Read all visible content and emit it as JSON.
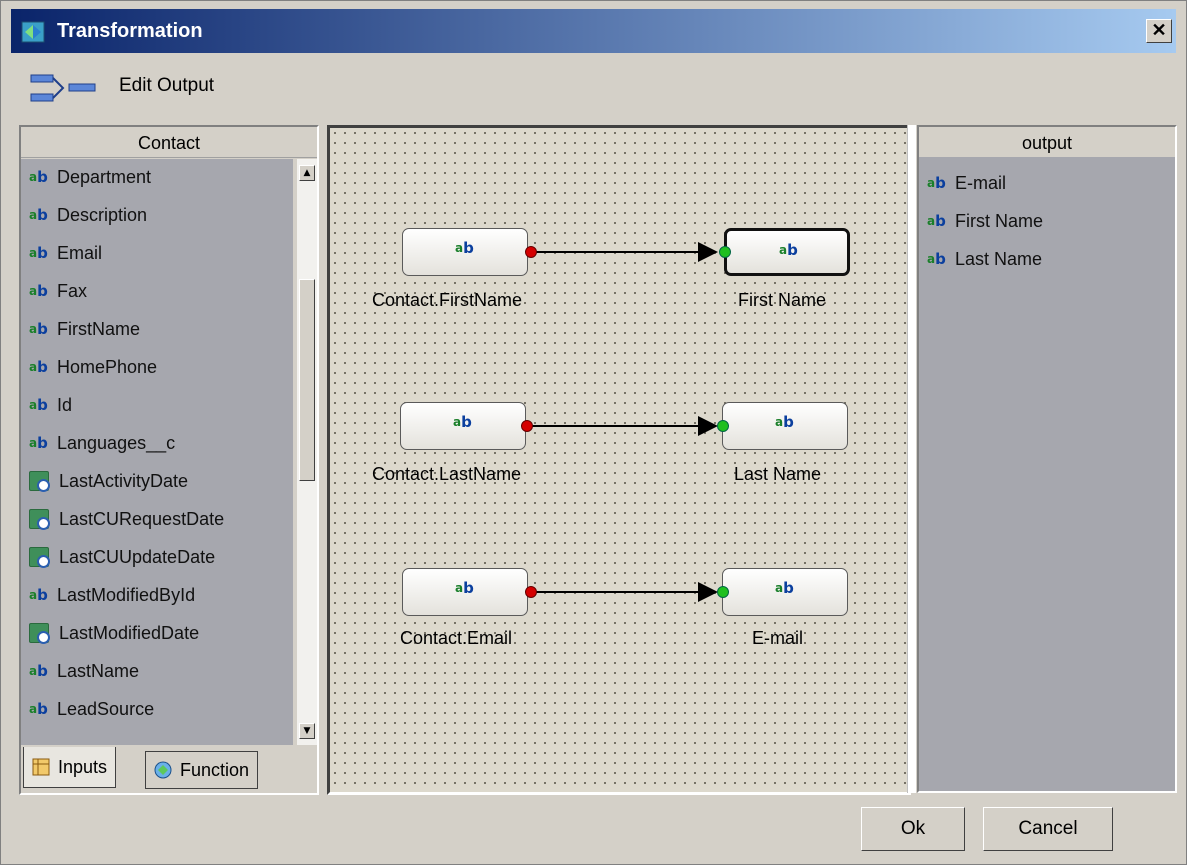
{
  "window": {
    "title": "Transformation",
    "close_label": "✕"
  },
  "toolbar": {
    "label": "Edit Output"
  },
  "left_panel": {
    "header": "Contact",
    "items": [
      {
        "label": "Department",
        "icon": "text-field-icon"
      },
      {
        "label": "Description",
        "icon": "text-field-icon"
      },
      {
        "label": "Email",
        "icon": "text-field-icon"
      },
      {
        "label": "Fax",
        "icon": "text-field-icon"
      },
      {
        "label": "FirstName",
        "icon": "text-field-icon"
      },
      {
        "label": "HomePhone",
        "icon": "text-field-icon"
      },
      {
        "label": "Id",
        "icon": "text-field-icon"
      },
      {
        "label": "Languages__c",
        "icon": "text-field-icon"
      },
      {
        "label": "LastActivityDate",
        "icon": "date-field-icon"
      },
      {
        "label": "LastCURequestDate",
        "icon": "date-field-icon"
      },
      {
        "label": "LastCUUpdateDate",
        "icon": "date-field-icon"
      },
      {
        "label": "LastModifiedById",
        "icon": "text-field-icon"
      },
      {
        "label": "LastModifiedDate",
        "icon": "date-field-icon"
      },
      {
        "label": "LastName",
        "icon": "text-field-icon"
      },
      {
        "label": "LeadSource",
        "icon": "text-field-icon"
      }
    ],
    "tabs": [
      {
        "label": "Inputs",
        "active": true
      },
      {
        "label": "Function",
        "active": false
      }
    ]
  },
  "canvas": {
    "mappings": [
      {
        "source_label": "Contact.FirstName",
        "target_label": "First Name",
        "target_selected": true
      },
      {
        "source_label": "Contact.LastName",
        "target_label": "Last Name",
        "target_selected": false
      },
      {
        "source_label": "Contact.Email",
        "target_label": "E-mail",
        "target_selected": false
      }
    ]
  },
  "right_panel": {
    "header": "output",
    "items": [
      {
        "label": "E-mail",
        "icon": "text-field-icon"
      },
      {
        "label": "First Name",
        "icon": "text-field-icon"
      },
      {
        "label": "Last Name",
        "icon": "text-field-icon"
      }
    ]
  },
  "buttons": {
    "ok": "Ok",
    "cancel": "Cancel"
  },
  "colors": {
    "title_start": "#0a246a",
    "title_end": "#a6caf0",
    "list_bg": "#a6a7ae",
    "port_out": "#d40000",
    "port_in": "#1fbf1f"
  }
}
